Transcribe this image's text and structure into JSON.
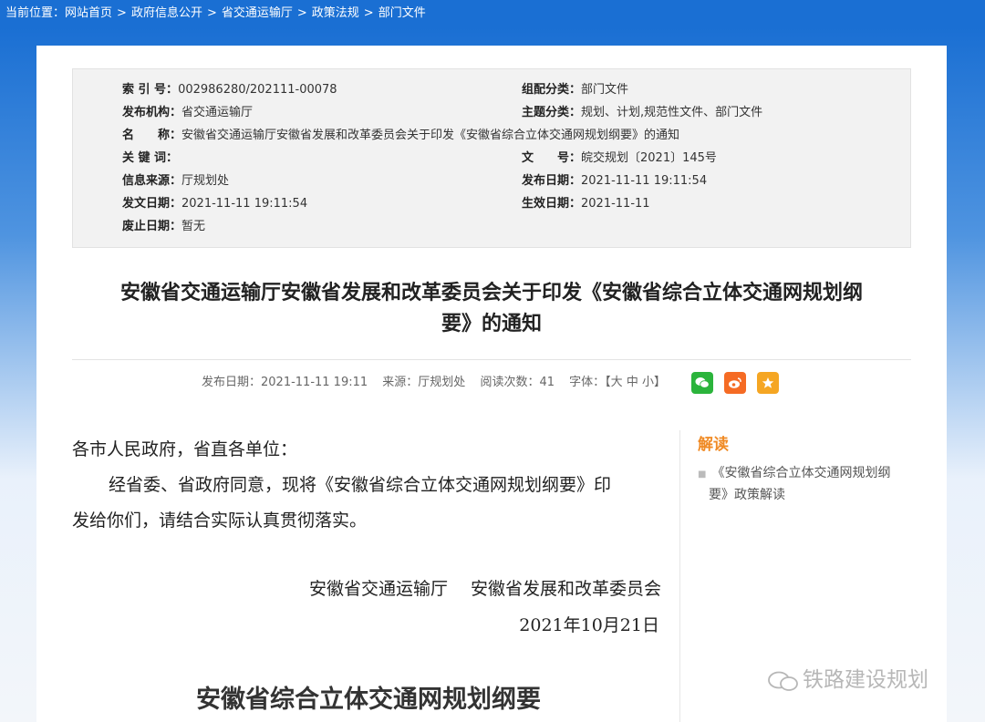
{
  "breadcrumb": {
    "prefix": "当前位置：",
    "items": [
      "网站首页",
      "政府信息公开",
      "省交通运输厅",
      "政策法规",
      "部门文件"
    ],
    "separator": ">"
  },
  "meta": {
    "left": [
      {
        "key": "索 引 号：",
        "value": "002986280/202111-00078"
      },
      {
        "key": "发布机构：",
        "value": "省交通运输厅"
      },
      {
        "key": "名　　称：",
        "value": "安徽省交通运输厅安徽省发展和改革委员会关于印发《安徽省综合立体交通网规划纲要》的通知"
      },
      {
        "key": "关 键 词：",
        "value": ""
      },
      {
        "key": "信息来源：",
        "value": "厅规划处"
      },
      {
        "key": "发文日期：",
        "value": "2021-11-11 19:11:54"
      },
      {
        "key": "废止日期：",
        "value": "暂无"
      }
    ],
    "right": [
      {
        "key": "组配分类：",
        "value": "部门文件"
      },
      {
        "key": "主题分类：",
        "value": "规划、计划,规范性文件、部门文件"
      },
      {
        "key": "文　　号：",
        "value": "皖交规划〔2021〕145号"
      },
      {
        "key": "发布日期：",
        "value": "2021-11-11 19:11:54"
      },
      {
        "key": "生效日期：",
        "value": "2021-11-11"
      }
    ]
  },
  "title_line1": "安徽省交通运输厅安徽省发展和改革委员会关于印发《安徽省综合立体交通网规划纲",
  "title_line2": "要》的通知",
  "info": {
    "publish": "发布日期：2021-11-11 19:11",
    "source": "来源：厅规划处",
    "reads": "阅读次数：41",
    "font_label": "字体：",
    "font_open": "【",
    "font_large": "大",
    "font_medium": "中",
    "font_small": "小",
    "font_close": "】"
  },
  "share": {
    "wechat": "wechat-icon",
    "weibo": "weibo-icon",
    "favorite": "star-icon"
  },
  "body": {
    "salutation": "各市人民政府，省直各单位：",
    "para1_line1": "经省委、省政府同意，现将《安徽省综合立体交通网规划纲要》印",
    "para1_line2": "发给你们，请结合实际认真贯彻落实。",
    "signatory": "安徽省交通运输厅　 安徽省发展和改革委员会",
    "date": "2021年10月21日",
    "subtitle": "安徽省综合立体交通网规划纲要"
  },
  "reading": {
    "title": "解读",
    "item_line1": "《安徽省综合立体交通网规划纲",
    "item_line2": "要》政策解读"
  },
  "watermark": "铁路建设规划",
  "colors": {
    "header_blue": "#1a6fd3",
    "accent_orange": "#f08a24"
  }
}
